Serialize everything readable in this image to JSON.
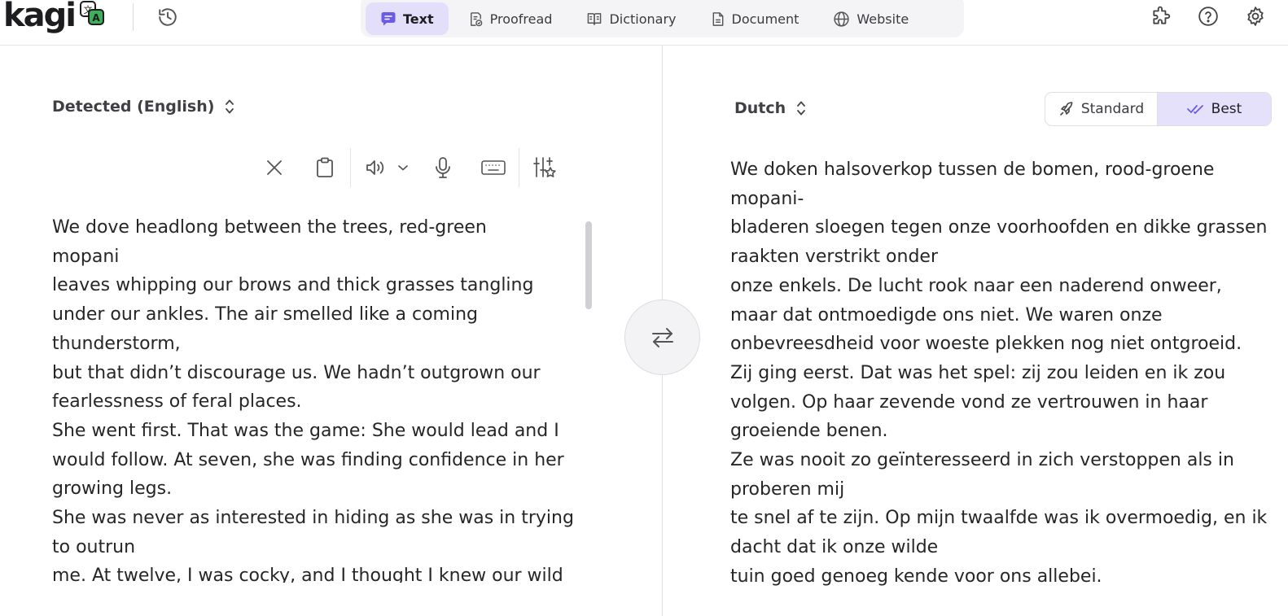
{
  "app": {
    "logo_text": "kagi"
  },
  "tabs": [
    {
      "label": "Text",
      "icon": "chat-icon",
      "active": true
    },
    {
      "label": "Proofread",
      "icon": "proofread-icon",
      "active": false
    },
    {
      "label": "Dictionary",
      "icon": "book-icon",
      "active": false
    },
    {
      "label": "Document",
      "icon": "document-icon",
      "active": false
    },
    {
      "label": "Website",
      "icon": "globe-icon",
      "active": false
    }
  ],
  "header_icons": [
    "puzzle-icon",
    "help-icon",
    "gear-icon"
  ],
  "source": {
    "language_label": "Detected (English)",
    "text": "We dove headlong between the trees, red-green\nmopani\nleaves whipping our brows and thick grasses tangling under our ankles. The air smelled like a coming thunderstorm,\nbut that didn’t discourage us. We hadn’t outgrown our fearlessness of feral places.\nShe went first. That was the game: She would lead and I would follow. At seven, she was finding confidence in her growing legs.\nShe was never as interested in hiding as she was in trying to outrun\nme. At twelve, I was cocky, and I thought I knew our wild garden well enough for both of us."
  },
  "target": {
    "language_label": "Dutch",
    "quality": {
      "standard_label": "Standard",
      "best_label": "Best",
      "selected": "Best"
    },
    "text": "We doken halsoverkop tussen de bomen, rood-groene mopani-\nbladeren sloegen tegen onze voorhoofden en dikke grassen raakten verstrikt onder\nonze enkels. De lucht rook naar een naderend onweer,\nmaar dat ontmoedigde ons niet. We waren onze onbevreesdheid voor woeste plekken nog niet ontgroeid.\nZij ging eerst. Dat was het spel: zij zou leiden en ik zou volgen. Op haar zevende vond ze vertrouwen in haar groeiende benen.\nZe was nooit zo geïnteresseerd in zich verstoppen als in proberen mij\nte snel af te zijn. Op mijn twaalfde was ik overmoedig, en ik dacht dat ik onze wilde\ntuin goed genoeg kende voor ons allebei."
  },
  "colors": {
    "accent": "#6b5ce7",
    "active_tab_bg": "#e3defa",
    "badge_green": "#3fae5a"
  }
}
